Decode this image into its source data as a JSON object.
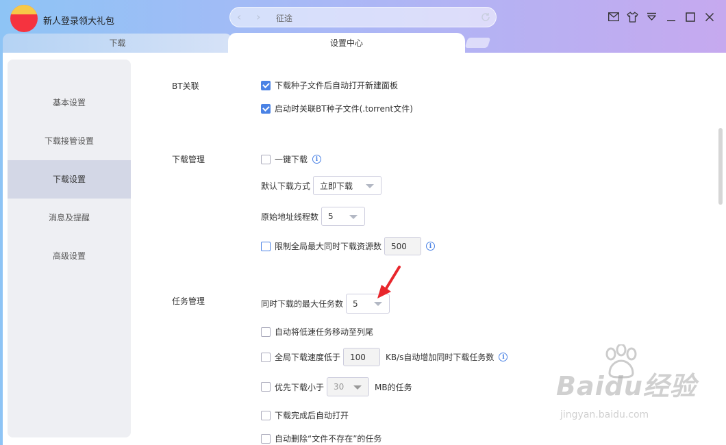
{
  "titlebar": {
    "promo_text": "新人登录领大礼包",
    "address_text": "征途",
    "back_arrow": "‹",
    "forward_arrow": "›"
  },
  "tabs": {
    "download": "下载",
    "settings": "设置中心"
  },
  "sidebar": {
    "items": [
      "基本设置",
      "下载接管设置",
      "下载设置",
      "消息及提醒",
      "高级设置"
    ],
    "active_index": 2
  },
  "sections": {
    "bt": {
      "title": "BT关联",
      "opt1": "下载种子文件后自动打开新建面板",
      "opt2": "启动时关联BT种子文件(.torrent文件)"
    },
    "download_mgmt": {
      "title": "下载管理",
      "one_click": "一键下载",
      "default_mode_label": "默认下载方式",
      "default_mode_value": "立即下载",
      "threads_label": "原始地址线程数",
      "threads_value": "5",
      "limit_label": "限制全局最大同时下载资源数",
      "limit_value": "500"
    },
    "task_mgmt": {
      "title": "任务管理",
      "max_tasks_label": "同时下载的最大任务数",
      "max_tasks_value": "5",
      "move_slow": "自动将低速任务移动至列尾",
      "speed_label": "全局下载速度低于",
      "speed_value": "100",
      "speed_suffix": "KB/s自动增加同时下载任务数",
      "prefer_small": "优先下载小于",
      "prefer_small_value": "30",
      "prefer_small_suffix": "MB的任务",
      "auto_open": "下载完成后自动打开",
      "auto_delete": "自动删除“文件不存在”的任务"
    }
  },
  "watermark": {
    "main": "Baidu经验",
    "sub": "jingyan.baidu.com"
  },
  "colors": {
    "accent": "#4a82e5",
    "annotation_arrow": "#e8262c"
  }
}
